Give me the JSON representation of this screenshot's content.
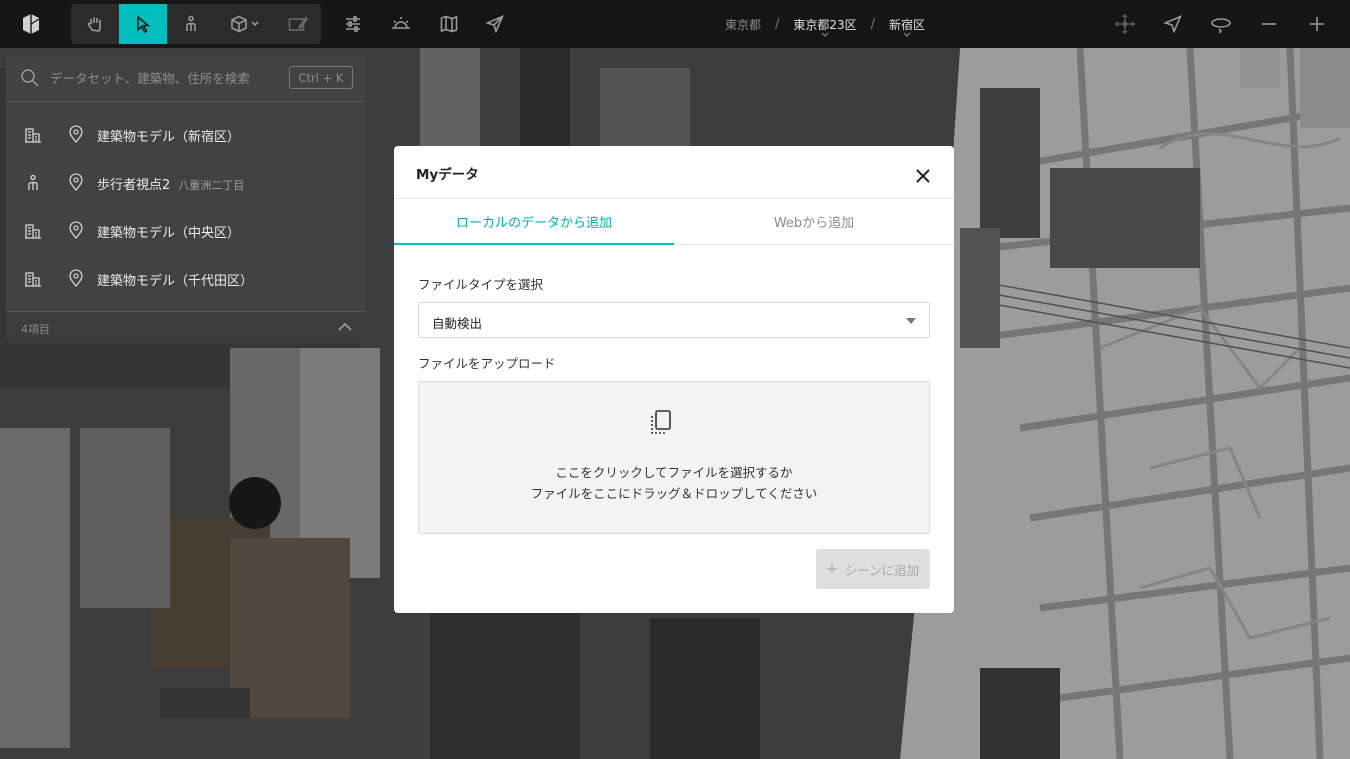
{
  "toolbar": {
    "logo_icon": "app-logo-icon",
    "tools": [
      {
        "icon": "hand-icon",
        "active": false
      },
      {
        "icon": "cursor-icon",
        "active": true
      },
      {
        "icon": "pedestrian-icon",
        "active": false
      },
      {
        "icon": "cube-icon",
        "active": false
      },
      {
        "icon": "sketch-icon",
        "active": false
      }
    ],
    "right_tools": [
      "sliders-icon",
      "sunrise-icon",
      "map-icon",
      "send-icon"
    ],
    "nav_tools": [
      "move-icon",
      "compass-icon",
      "rotate-icon",
      "zoom-out-icon",
      "zoom-in-icon"
    ],
    "accent_color": "#00bebe"
  },
  "breadcrumb": {
    "items": [
      "東京都",
      "東京都23区",
      "新宿区"
    ],
    "separator": "/"
  },
  "search": {
    "placeholder": "データセット、建築物、住所を検索",
    "shortcut": "Ctrl + K"
  },
  "layers": {
    "items": [
      {
        "icon": "building-icon",
        "name": "建築物モデル（新宿区）",
        "sub": ""
      },
      {
        "icon": "pedestrian-icon",
        "name": "歩行者視点2",
        "sub": "八重洲二丁目"
      },
      {
        "icon": "building-icon",
        "name": "建築物モデル（中央区）",
        "sub": ""
      },
      {
        "icon": "building-icon",
        "name": "建築物モデル（千代田区）",
        "sub": ""
      }
    ],
    "count": "4項目"
  },
  "modal": {
    "title": "Myデータ",
    "tabs": [
      {
        "label": "ローカルのデータから追加",
        "active": true
      },
      {
        "label": "Webから追加",
        "active": false
      }
    ],
    "file_type_label": "ファイルタイプを選択",
    "file_type_value": "自動検出",
    "upload_label": "ファイルをアップロード",
    "dropzone_line1": "ここをクリックしてファイルを選択するか",
    "dropzone_line2": "ファイルをここにドラッグ＆ドロップしてください",
    "add_button": "シーンに追加"
  }
}
